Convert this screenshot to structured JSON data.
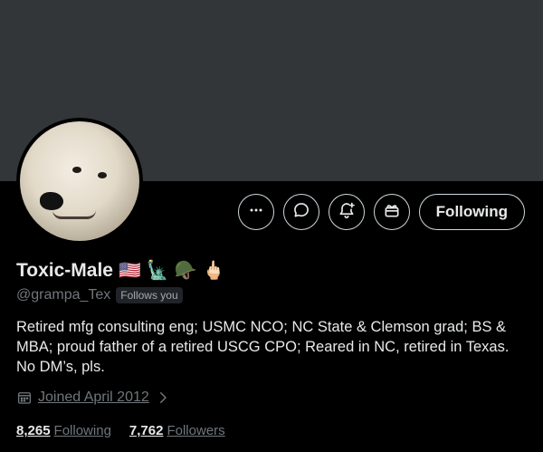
{
  "profile": {
    "display_name": "Toxic-Male",
    "name_emojis": [
      "🇺🇸",
      "🗽",
      "🪖",
      "🖕🏻"
    ],
    "handle": "@grampa_Tex",
    "follows_you_badge": "Follows you",
    "bio": "Retired mfg consulting eng; USMC NCO; NC State & Clemson grad; BS & MBA; proud father of a retired USCG CPO; Reared in NC, retired in Texas. No DM’s, pls.",
    "joined": "Joined April 2012",
    "following_count": "8,265",
    "following_label": "Following",
    "followers_count": "7,762",
    "followers_label": "Followers"
  },
  "actions": {
    "more_icon": "more-horizontal-icon",
    "message_icon": "message-icon",
    "notify_icon": "bell-plus-icon",
    "subscribe_icon": "gift-icon",
    "follow_button_label": "Following"
  },
  "colors": {
    "background": "#000000",
    "banner": "#333639",
    "primary_text": "#e7e9ea",
    "secondary_text": "#71767b",
    "button_border": "#cfd9de"
  }
}
